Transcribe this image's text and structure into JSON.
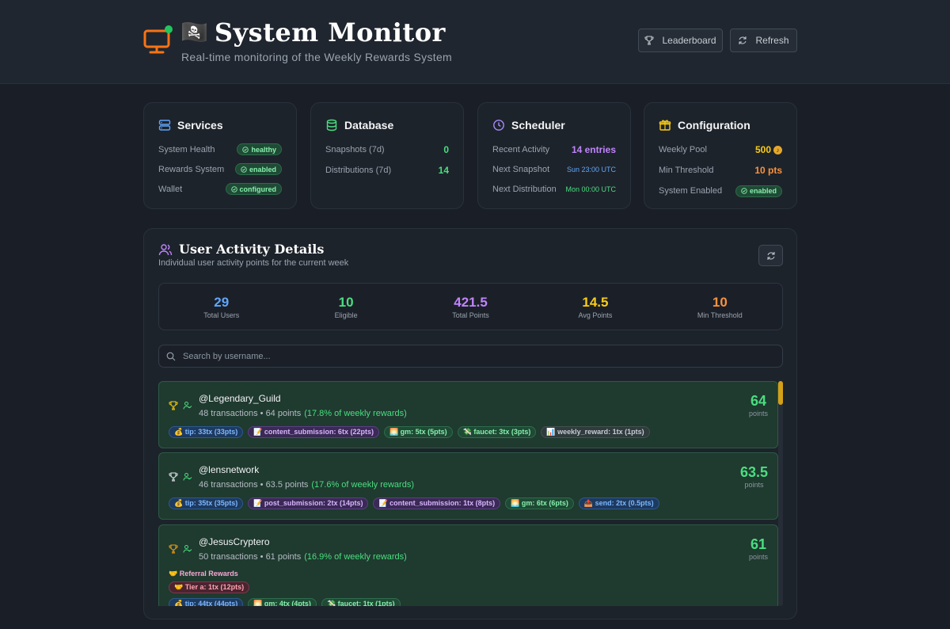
{
  "header": {
    "pirate_emoji": "🏴‍☠️",
    "title": "System Monitor",
    "subtitle": "Real-time monitoring of the Weekly Rewards System",
    "leaderboard_label": "Leaderboard",
    "refresh_label": "Refresh"
  },
  "services": {
    "title": "Services",
    "rows": [
      {
        "label": "System Health",
        "value": "healthy"
      },
      {
        "label": "Rewards System",
        "value": "enabled"
      },
      {
        "label": "Wallet",
        "value": "configured"
      }
    ]
  },
  "database": {
    "title": "Database",
    "rows": [
      {
        "label": "Snapshots (7d)",
        "value": "0"
      },
      {
        "label": "Distributions (7d)",
        "value": "14"
      }
    ]
  },
  "scheduler": {
    "title": "Scheduler",
    "rows": [
      {
        "label": "Recent Activity",
        "value": "14 entries"
      },
      {
        "label": "Next Snapshot",
        "value": "Sun 23:00 UTC"
      },
      {
        "label": "Next Distribution",
        "value": "Mon 00:00 UTC"
      }
    ]
  },
  "configuration": {
    "title": "Configuration",
    "rows": [
      {
        "label": "Weekly Pool",
        "value": "500"
      },
      {
        "label": "Min Threshold",
        "value": "10 pts"
      },
      {
        "label": "System Enabled",
        "value": "enabled"
      }
    ]
  },
  "activity": {
    "title": "User Activity Details",
    "subtitle": "Individual user activity points for the current week",
    "search_placeholder": "Search by username...",
    "stats": [
      {
        "value": "29",
        "label": "Total Users",
        "color": "#60a5fa"
      },
      {
        "value": "10",
        "label": "Eligible",
        "color": "#4ade80"
      },
      {
        "value": "421.5",
        "label": "Total Points",
        "color": "#c084fc"
      },
      {
        "value": "14.5",
        "label": "Avg Points",
        "color": "#facc15"
      },
      {
        "value": "10",
        "label": "Min Threshold",
        "color": "#fb923c"
      }
    ],
    "points_unit": "points",
    "users": [
      {
        "name": "@Legendary_Guild",
        "meta": "48 transactions • 64 points",
        "pct": "(17.8% of weekly rewards)",
        "points": "64",
        "tags": [
          {
            "text": "💰 tip: 33tx (33pts)",
            "style": "blue"
          },
          {
            "text": "📝 content_submission: 6tx (22pts)",
            "style": "purple"
          },
          {
            "text": "🌅 gm: 5tx (5pts)",
            "style": "green"
          },
          {
            "text": "💸 faucet: 3tx (3pts)",
            "style": "green"
          },
          {
            "text": "📊 weekly_reward: 1tx (1pts)",
            "style": "gray"
          }
        ]
      },
      {
        "name": "@lensnetwork",
        "meta": "46 transactions • 63.5 points",
        "pct": "(17.6% of weekly rewards)",
        "points": "63.5",
        "tags": [
          {
            "text": "💰 tip: 35tx (35pts)",
            "style": "blue"
          },
          {
            "text": "📝 post_submission: 2tx (14pts)",
            "style": "purple"
          },
          {
            "text": "📝 content_submission: 1tx (8pts)",
            "style": "purple"
          },
          {
            "text": "🌅 gm: 6tx (6pts)",
            "style": "green"
          },
          {
            "text": "📤 send: 2tx (0.5pts)",
            "style": "blue"
          }
        ]
      },
      {
        "name": "@JesusCryptero",
        "meta": "50 transactions • 61 points",
        "pct": "(16.9% of weekly rewards)",
        "points": "61",
        "referral_label": "🤝 Referral Rewards",
        "referral_tag": "🤝 Tier a: 1tx (12pts)",
        "tags": [
          {
            "text": "💰 tip: 44tx (44pts)",
            "style": "blue"
          },
          {
            "text": "🌅 gm: 4tx (4pts)",
            "style": "green"
          },
          {
            "text": "💸 faucet: 1tx (1pts)",
            "style": "green"
          }
        ]
      }
    ]
  },
  "colors": {
    "accent_orange": "#f97316",
    "scroll_thumb": "#d4a017"
  }
}
